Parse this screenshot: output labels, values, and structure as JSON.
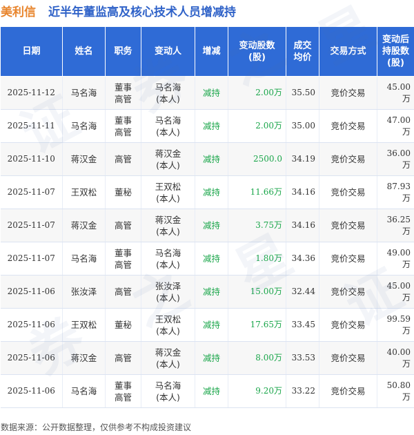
{
  "title": {
    "company": "美利信",
    "heading": "近半年董监高及核心技术人员增减持"
  },
  "table": {
    "headers": [
      "日期",
      "姓名",
      "职务",
      "变动人",
      "增减",
      "变动股数\n(股)",
      "成交\n均价",
      "交易方式",
      "变动后\n持股数\n(股)"
    ],
    "rows": [
      [
        "2025-11-12",
        "马名海",
        "董事\n高管",
        "马名海\n(本人)",
        "减持",
        "2.00万",
        "35.50",
        "竞价交易",
        "45.00万"
      ],
      [
        "2025-11-11",
        "马名海",
        "董事\n高管",
        "马名海\n(本人)",
        "减持",
        "2.00万",
        "35.00",
        "竞价交易",
        "47.00万"
      ],
      [
        "2025-11-10",
        "蒋汉金",
        "高管",
        "蒋汉金\n(本人)",
        "减持",
        "2500.0",
        "34.19",
        "竞价交易",
        "36.00万"
      ],
      [
        "2025-11-07",
        "王双松",
        "董秘",
        "王双松\n(本人)",
        "减持",
        "11.66万",
        "34.16",
        "竞价交易",
        "87.93万"
      ],
      [
        "2025-11-07",
        "蒋汉金",
        "高管",
        "蒋汉金\n(本人)",
        "减持",
        "3.75万",
        "34.16",
        "竞价交易",
        "36.25万"
      ],
      [
        "2025-11-07",
        "马名海",
        "董事\n高管",
        "马名海\n(本人)",
        "减持",
        "1.80万",
        "34.36",
        "竞价交易",
        "49.00万"
      ],
      [
        "2025-11-06",
        "张汝泽",
        "高管",
        "张汝泽\n(本人)",
        "减持",
        "15.00万",
        "32.44",
        "竞价交易",
        "45.00万"
      ],
      [
        "2025-11-06",
        "王双松",
        "董秘",
        "王双松\n(本人)",
        "减持",
        "17.65万",
        "33.45",
        "竞价交易",
        "99.59万"
      ],
      [
        "2025-11-06",
        "蒋汉金",
        "高管",
        "蒋汉金\n(本人)",
        "减持",
        "8.00万",
        "33.53",
        "竞价交易",
        "40.00万"
      ],
      [
        "2025-11-06",
        "马名海",
        "董事\n高管",
        "马名海\n(本人)",
        "减持",
        "9.20万",
        "33.22",
        "竞价交易",
        "50.80万"
      ]
    ]
  },
  "watermark": [
    "证",
    "券",
    "之",
    "星"
  ],
  "footer": {
    "source": "数据来源：公开数据整理，仅供参考不构成投资建议"
  },
  "colors": {
    "header_bg": "#2f6bd6",
    "company": "#e8852d",
    "heading": "#2f62c8",
    "decrease": "#1aa64a"
  }
}
